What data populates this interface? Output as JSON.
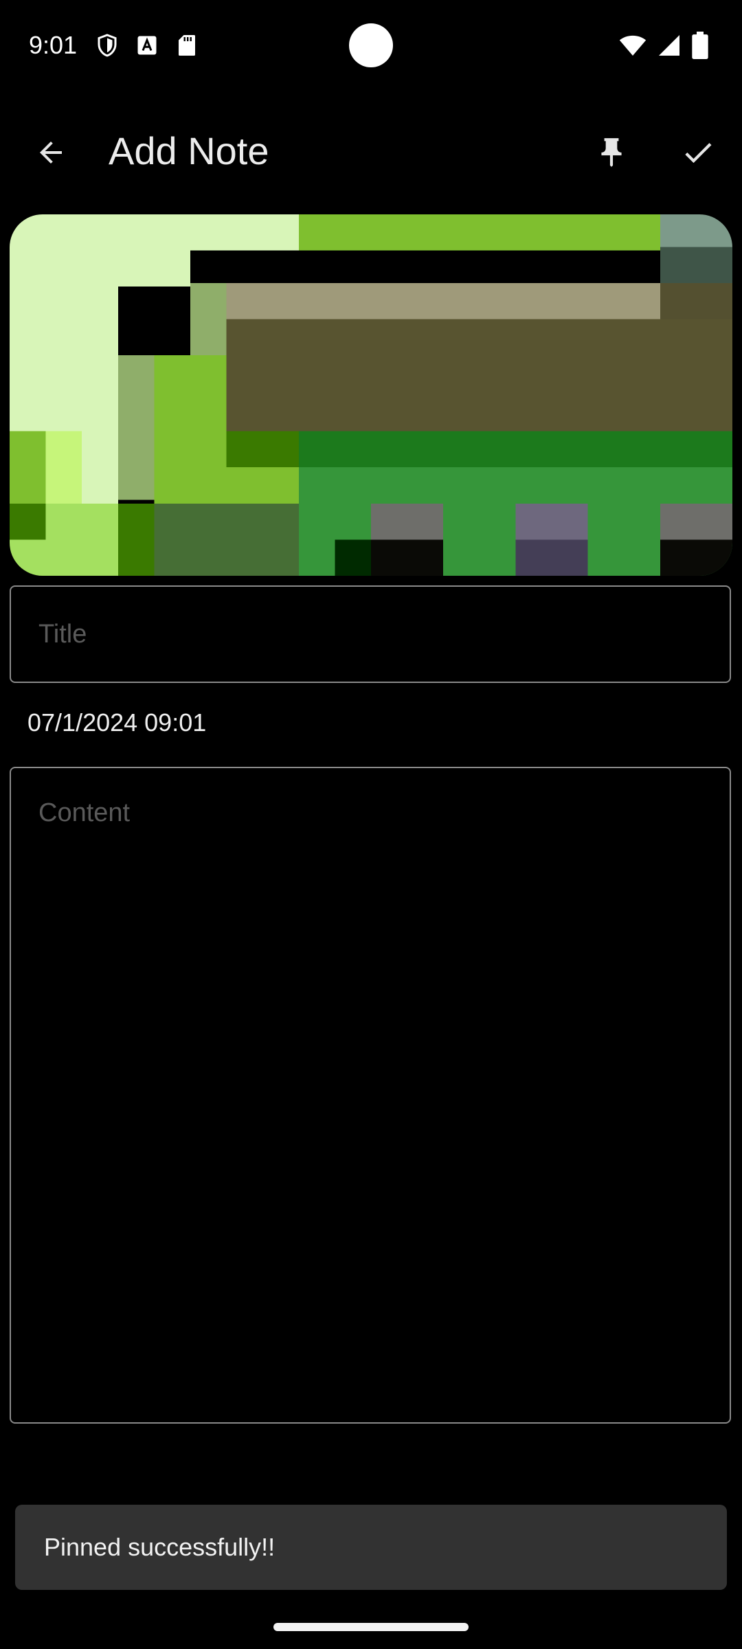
{
  "status_bar": {
    "time": "9:01",
    "left_icons": [
      "shield-icon",
      "font-icon",
      "sd-card-icon"
    ],
    "right_icons": [
      "wifi-icon",
      "signal-icon",
      "battery-icon"
    ]
  },
  "app_bar": {
    "title": "Add Note",
    "back_icon": "arrow-back-icon",
    "pin_icon": "pin-icon",
    "save_icon": "check-icon"
  },
  "note": {
    "image_description_icon": "note-image",
    "title_placeholder": "Title",
    "title_value": "",
    "date": "07/1/2024 09:01",
    "content_placeholder": "Content",
    "content_value": ""
  },
  "snackbar": {
    "message": "Pinned successfully!!"
  },
  "colors": {
    "background": "#000000",
    "field_border": "#8a8a8a",
    "placeholder": "#5a5a5a",
    "snackbar_bg": "#323232"
  }
}
